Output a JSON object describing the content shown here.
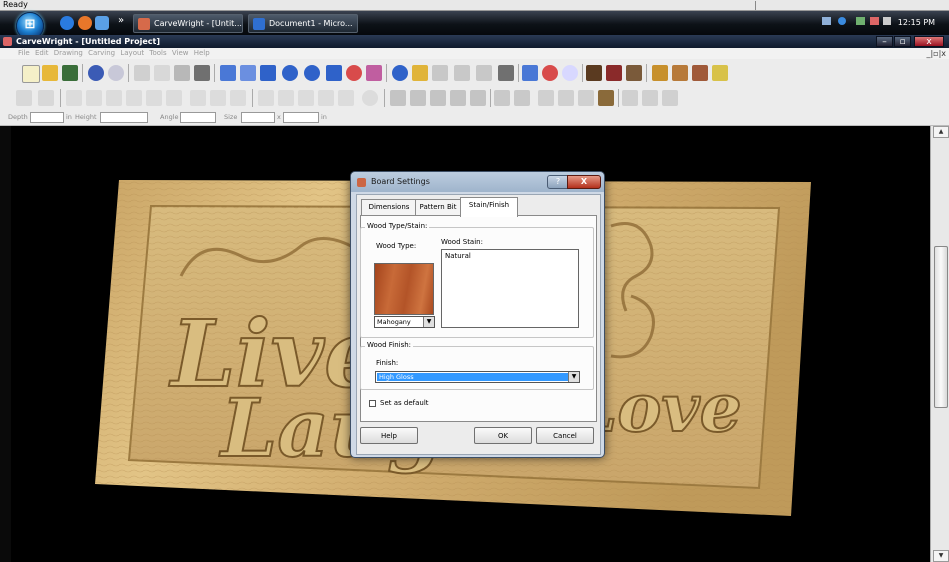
{
  "status": {
    "text": "Ready"
  },
  "taskbar": {
    "tasks": [
      {
        "label": "CarveWright - [Untit...",
        "color": "#d66a4a"
      },
      {
        "label": "Document1 - Micro...",
        "color": "#2f6fd1"
      }
    ],
    "overflow": "»",
    "clock": "12:15 PM"
  },
  "window": {
    "title": "CarveWright - [Untitled Project]",
    "minimize": "–",
    "maximize": "▫",
    "close": "x",
    "mdi_controls": "_|▫|x"
  },
  "menu": {
    "items": [
      "File",
      "Edit",
      "Drawing",
      "Carving",
      "Layout",
      "Tools",
      "View",
      "Help"
    ]
  },
  "props_bar": {
    "depth_label": "Depth",
    "depth_unit": "in",
    "height_label": "Height",
    "angle_label": "Angle",
    "size_label": "Size",
    "size_sep": "x",
    "size_unit": "in"
  },
  "scrollbar": {
    "up": "▲",
    "down": "▼"
  },
  "dialog": {
    "title": "Board Settings",
    "help_glyph": "?",
    "close_glyph": "X",
    "tabs": [
      "Dimensions",
      "Pattern Bit",
      "Stain/Finish"
    ],
    "wood_group_label": "Wood Type/Stain:",
    "wood_type_label": "Wood Type:",
    "wood_stain_label": "Wood Stain:",
    "wood_type_value": "Mahogany",
    "stain_items": [
      "Natural"
    ],
    "finish_group_label": "Wood Finish:",
    "finish_label": "Finish:",
    "finish_value": "High Gloss",
    "set_default_label": "Set as default",
    "buttons": {
      "help": "Help",
      "ok": "OK",
      "cancel": "Cancel"
    },
    "swatch_color": "#b8582a"
  },
  "board": {
    "lines": [
      "Live",
      "Laugh",
      "Love"
    ]
  }
}
